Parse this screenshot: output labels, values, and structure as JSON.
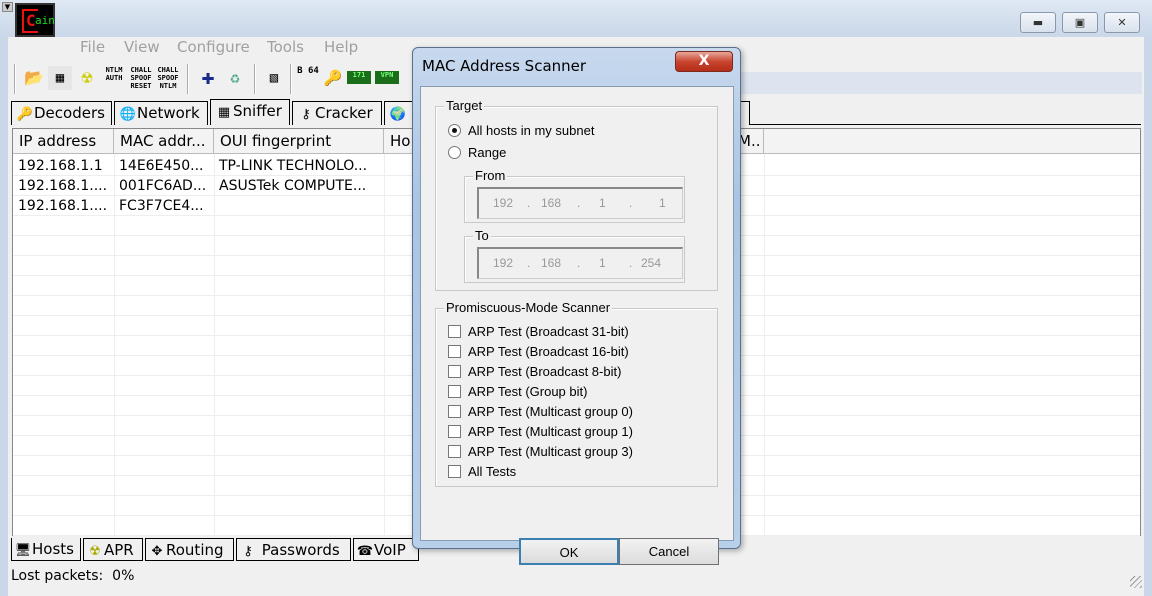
{
  "app": {
    "logo_text": "Cain"
  },
  "menu": [
    "File",
    "View",
    "Configure",
    "Tools",
    "Help"
  ],
  "toolbar": {
    "ntlm_auth": "NTLM AUTH",
    "chall_reset": "CHALL SPOOF RESET",
    "chall_ntlm": "CHALL SPOOF NTLM",
    "b64": "B 64"
  },
  "tabs": [
    "Decoders",
    "Network",
    "Sniffer",
    "Cracker"
  ],
  "columns": [
    "IP address",
    "MAC addr...",
    "OUI fingerprint",
    "Ho",
    "M.."
  ],
  "rows": [
    {
      "ip": "192.168.1.1",
      "mac": "14E6E450...",
      "oui": "TP-LINK TECHNOLO..."
    },
    {
      "ip": "192.168.1....",
      "mac": "001FC6AD...",
      "oui": "ASUSTek COMPUTE..."
    },
    {
      "ip": "192.168.1....",
      "mac": "FC3F7CE4...",
      "oui": ""
    }
  ],
  "bottom_tabs": [
    "Hosts",
    "APR",
    "Routing",
    "Passwords",
    "VoIP"
  ],
  "status": {
    "label": "Lost packets:",
    "value": "0%"
  },
  "dialog": {
    "title": "MAC Address Scanner",
    "close": "X",
    "target_label": "Target",
    "radio_all": "All hosts in my subnet",
    "radio_all_selected": true,
    "radio_range": "Range",
    "from_label": "From",
    "from": [
      "192",
      "168",
      "1",
      "1"
    ],
    "to_label": "To",
    "to": [
      "192",
      "168",
      "1",
      "254"
    ],
    "promisc_label": "Promiscuous-Mode Scanner",
    "tests": [
      "ARP Test (Broadcast 31-bit)",
      "ARP Test (Broadcast 16-bit)",
      "ARP Test (Broadcast 8-bit)",
      "ARP Test (Group bit)",
      "ARP Test (Multicast group 0)",
      "ARP Test (Multicast group 1)",
      "ARP Test (Multicast group 3)",
      "All Tests"
    ],
    "ok": "OK",
    "cancel": "Cancel"
  }
}
